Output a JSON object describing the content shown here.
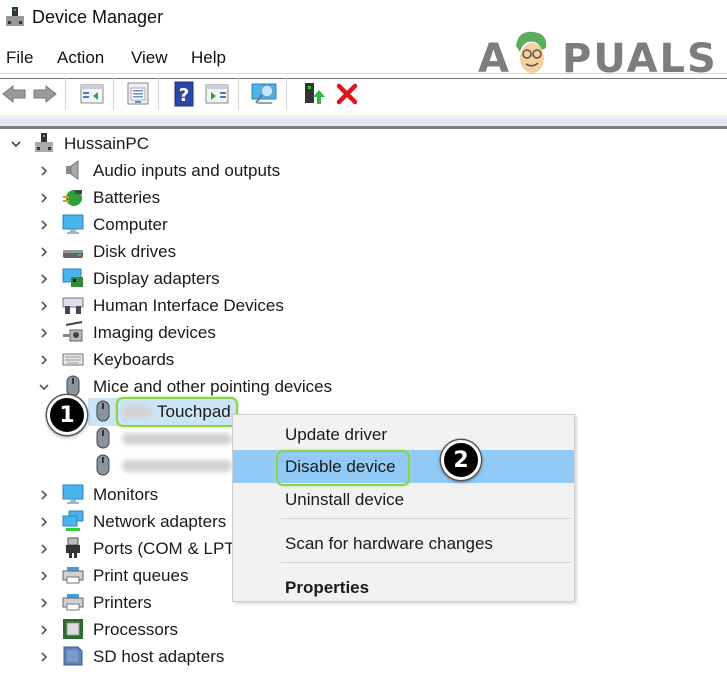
{
  "window": {
    "title": "Device Manager",
    "icon": "device-manager-icon"
  },
  "menubar": {
    "items": [
      "File",
      "Action",
      "View",
      "Help"
    ]
  },
  "toolbar": {
    "buttons": [
      {
        "name": "back-button",
        "icon": "arrow-left-icon"
      },
      {
        "name": "forward-button",
        "icon": "arrow-right-icon"
      },
      {
        "name": "show-hide-console-tree-button",
        "icon": "console-tree-icon"
      },
      {
        "name": "properties-button",
        "icon": "properties-sheet-icon"
      },
      {
        "name": "help-button",
        "icon": "help-question-icon"
      },
      {
        "name": "show-action-pane-button",
        "icon": "action-pane-icon"
      },
      {
        "name": "scan-hardware-button",
        "icon": "scan-monitor-icon"
      },
      {
        "name": "update-driver-button",
        "icon": "update-driver-icon"
      },
      {
        "name": "uninstall-button",
        "icon": "red-x-icon"
      }
    ]
  },
  "watermark": {
    "text_left": "A",
    "text_right": "PUALS"
  },
  "tree": {
    "root": {
      "label": "HussainPC",
      "expanded": true
    },
    "categories": [
      {
        "label": "Audio inputs and outputs",
        "icon": "speaker-icon",
        "expanded": false
      },
      {
        "label": "Batteries",
        "icon": "battery-icon",
        "expanded": false
      },
      {
        "label": "Computer",
        "icon": "computer-monitor-icon",
        "expanded": false
      },
      {
        "label": "Disk drives",
        "icon": "disk-drive-icon",
        "expanded": false
      },
      {
        "label": "Display adapters",
        "icon": "display-adapter-icon",
        "expanded": false
      },
      {
        "label": "Human Interface Devices",
        "icon": "hid-icon",
        "expanded": false
      },
      {
        "label": "Imaging devices",
        "icon": "camera-icon",
        "expanded": false
      },
      {
        "label": "Keyboards",
        "icon": "keyboard-icon",
        "expanded": false
      },
      {
        "label": "Mice and other pointing devices",
        "icon": "mouse-icon",
        "expanded": true
      },
      {
        "label": "Monitors",
        "icon": "monitor-icon",
        "expanded": false
      },
      {
        "label": "Network adapters",
        "icon": "network-adapter-icon",
        "expanded": false
      },
      {
        "label": "Ports (COM & LPT)",
        "icon": "port-icon",
        "expanded": false
      },
      {
        "label": "Print queues",
        "icon": "printer-icon",
        "expanded": false
      },
      {
        "label": "Printers",
        "icon": "printer-icon",
        "expanded": false
      },
      {
        "label": "Processors",
        "icon": "processor-icon",
        "expanded": false
      },
      {
        "label": "SD host adapters",
        "icon": "sd-card-icon",
        "expanded": false
      }
    ],
    "mice_children": [
      {
        "label": "Touchpad",
        "selected": true,
        "prefix_blurred": true
      },
      {
        "label": "",
        "blurred": true
      },
      {
        "label": "",
        "blurred": true
      }
    ]
  },
  "context_menu": {
    "items": [
      {
        "label": "Update driver",
        "highlighted": false,
        "bold": false
      },
      {
        "label": "Disable device",
        "highlighted": true,
        "bold": false
      },
      {
        "label": "Uninstall device",
        "highlighted": false,
        "bold": false
      },
      {
        "label": "Scan for hardware changes",
        "highlighted": false,
        "bold": false
      },
      {
        "label": "Properties",
        "highlighted": false,
        "bold": true
      }
    ]
  },
  "annotations": {
    "step1": "1",
    "step2": "2",
    "highlight_color": "#8ad24a"
  },
  "colors": {
    "selection": "#cce4f7",
    "menu_highlight": "#91c9f7",
    "menu_bg": "#f2f2f2"
  }
}
